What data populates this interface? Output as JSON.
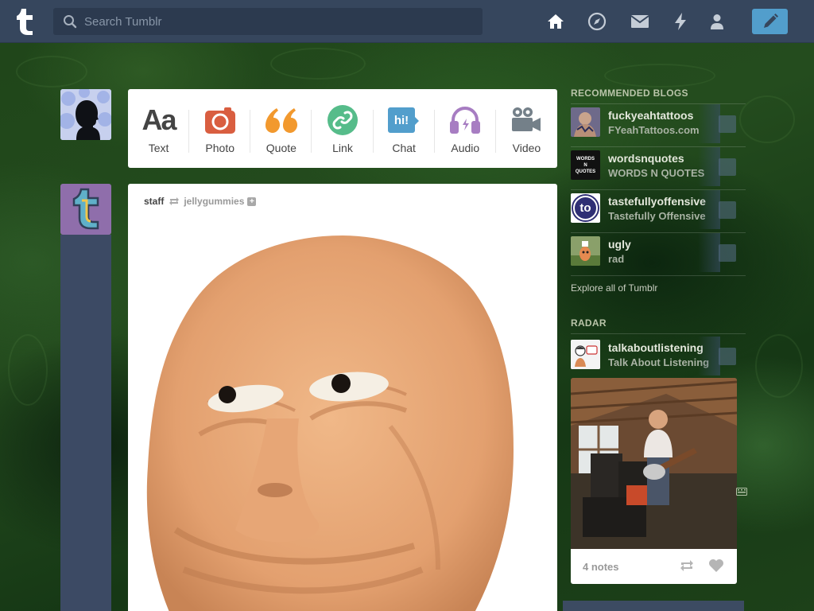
{
  "topbar": {
    "search_placeholder": "Search Tumblr",
    "nav_icons": [
      "home-icon",
      "explore-icon",
      "inbox-icon",
      "activity-icon",
      "account-icon"
    ],
    "compose_icon": "pencil-icon",
    "accent": "#529ecc",
    "bar_color": "#36465d"
  },
  "post_types": [
    {
      "label": "Text",
      "icon": "text-icon",
      "color": "#444444"
    },
    {
      "label": "Photo",
      "icon": "camera-icon",
      "color": "#d95e40"
    },
    {
      "label": "Quote",
      "icon": "quote-icon",
      "color": "#f2992e"
    },
    {
      "label": "Link",
      "icon": "link-icon",
      "color": "#56bc8a"
    },
    {
      "label": "Chat",
      "icon": "chat-icon",
      "color": "#529ecc"
    },
    {
      "label": "Audio",
      "icon": "audio-icon",
      "color": "#a77dc2"
    },
    {
      "label": "Video",
      "icon": "video-icon",
      "color": "#748089"
    }
  ],
  "post": {
    "author": "staff",
    "reblogged_from": "jellygummies"
  },
  "sidebar": {
    "recommended_heading": "Recommended Blogs",
    "recommended": [
      {
        "name": "fuckyeahtattoos",
        "title": "FYeahTattoos.com"
      },
      {
        "name": "wordsnquotes",
        "title": "WORDS N QUOTES",
        "avatar_text": "WORDS N QUOTES"
      },
      {
        "name": "tastefullyoffensive",
        "title": "Tastefully Offensive",
        "avatar_text": "to"
      },
      {
        "name": "ugly",
        "title": "rad"
      }
    ],
    "explore": "Explore all of Tumblr",
    "radar_heading": "Radar",
    "radar_blog": {
      "name": "talkaboutlistening",
      "title": "Talk About Listening"
    },
    "radar_notes": "4 notes"
  }
}
